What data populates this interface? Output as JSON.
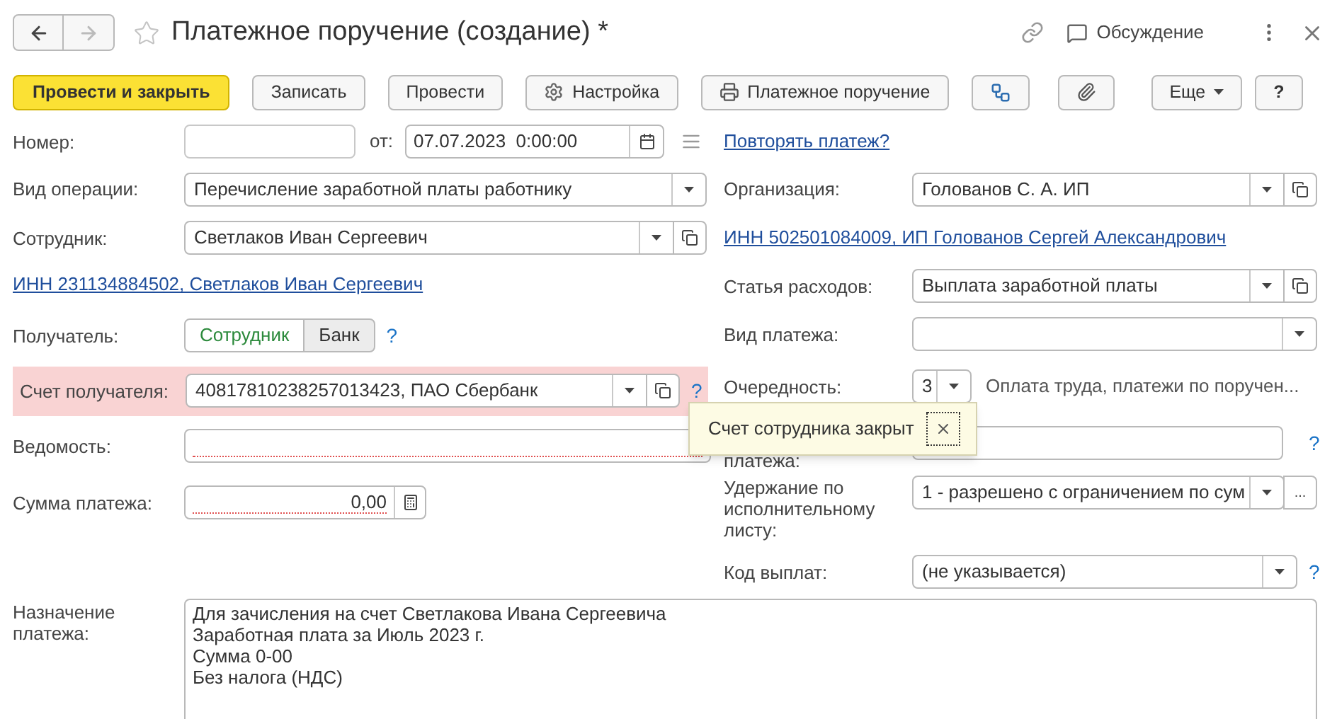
{
  "window": {
    "title": "Платежное поручение (создание) *",
    "favorite": false,
    "discussion": "Обсуждение"
  },
  "commands": [
    {
      "label": "Провести и закрыть",
      "kind": "primary"
    },
    {
      "label": "Записать",
      "kind": "plain"
    },
    {
      "label": "Провести",
      "kind": "plain"
    },
    {
      "label": "Настройка",
      "kind": "gear"
    },
    {
      "label": "Платежное поручение",
      "kind": "print"
    },
    {
      "kind": "structure"
    },
    {
      "kind": "attach"
    },
    {
      "label": "Еще",
      "kind": "menu"
    },
    {
      "label": "?",
      "kind": "plain"
    }
  ],
  "number": {
    "label": "Номер:"
  },
  "date": {
    "label": "от:",
    "value": "07.07.2023  0:00:00"
  },
  "repeat_link": "Повторять платеж?",
  "operation": {
    "label": "Вид операции:",
    "value": "Перечисление заработной платы работнику"
  },
  "employee": {
    "label": "Сотрудник:",
    "value": "Светлаков Иван Сергеевич"
  },
  "employee_link": "ИНН 231134884502, Светлаков Иван Сергеевич",
  "recipient": {
    "label": "Получатель:",
    "help": "?",
    "options": [
      {
        "label": "Сотрудник",
        "selected": true
      },
      {
        "label": "Банк",
        "selected": false
      }
    ]
  },
  "account": {
    "label": "Счет получателя:",
    "value": "40817810238257013423, ПАО Сбербанк",
    "error": true,
    "help": "?"
  },
  "statement": {
    "label": "Ведомость:",
    "required": true
  },
  "amount": {
    "label": "Сумма платежа:",
    "value": "0,00",
    "required": true
  },
  "organization": {
    "label": "Организация:",
    "value": "Голованов С. А. ИП"
  },
  "organization_link": "ИНН 502501084009, ИП Голованов Сергей Александрович",
  "expense": {
    "label": "Статья расходов:",
    "value": "Выплата заработной платы"
  },
  "payment_type": {
    "label": "Вид платежа:"
  },
  "priority": {
    "label": "Очередность:",
    "value": "3",
    "description": "Оплата труда, платежи по поручен..."
  },
  "payment_id": {
    "label": "платежа:",
    "help": "?"
  },
  "withholding": {
    "label": "Удержание по исполнительному листу:",
    "value": "1 - разрешено с ограничением по сум",
    "choose": "..."
  },
  "payment_code": {
    "label": "Код выплат:",
    "value": "(не указывается)",
    "help": "?"
  },
  "purpose": {
    "label": "Назначение платежа:",
    "lines": [
      "Для зачисления на счет Светлакова Ивана Сергеевича",
      "Заработная плата за Июль 2023 г.",
      "Сумма 0-00",
      "Без налога (НДС)"
    ]
  },
  "tooltip": {
    "text": "Счет сотрудника закрыт"
  }
}
